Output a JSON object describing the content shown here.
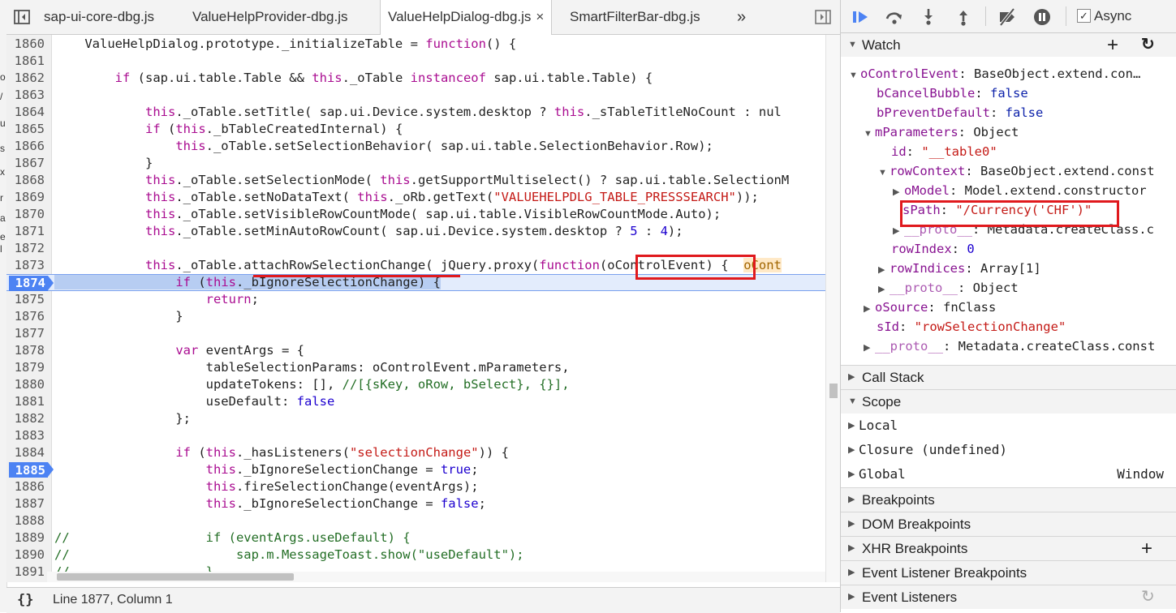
{
  "tabs": {
    "items": [
      {
        "label": "sap-ui-core-dbg.js"
      },
      {
        "label": "ValueHelpProvider-dbg.js"
      },
      {
        "label": "ValueHelpDialog-dbg.js",
        "close": "×"
      },
      {
        "label": "SmartFilterBar-dbg.js"
      }
    ],
    "more": "»"
  },
  "code": {
    "lines": [
      {
        "n": "1860",
        "t": "    ValueHelpDialog.prototype._initializeTable = function() {"
      },
      {
        "n": "1861",
        "t": ""
      },
      {
        "n": "1862",
        "t": "        if (sap.ui.table.Table && this._oTable instanceof sap.ui.table.Table) {"
      },
      {
        "n": "1863",
        "t": ""
      },
      {
        "n": "1864",
        "t": "            this._oTable.setTitle( sap.ui.Device.system.desktop ? this._sTableTitleNoCount : nul"
      },
      {
        "n": "1865",
        "t": "            if (this._bTableCreatedInternal) {"
      },
      {
        "n": "1866",
        "t": "                this._oTable.setSelectionBehavior( sap.ui.table.SelectionBehavior.Row);"
      },
      {
        "n": "1867",
        "t": "            }"
      },
      {
        "n": "1868",
        "t": "            this._oTable.setSelectionMode( this.getSupportMultiselect() ? sap.ui.table.SelectionM"
      },
      {
        "n": "1869",
        "t": "            this._oTable.setNoDataText( this._oRb.getText(\"VALUEHELPDLG_TABLE_PRESSSEARCH\"));"
      },
      {
        "n": "1870",
        "t": "            this._oTable.setVisibleRowCountMode( sap.ui.table.VisibleRowCountMode.Auto);"
      },
      {
        "n": "1871",
        "t": "            this._oTable.setMinAutoRowCount( sap.ui.Device.system.desktop ? 5 : 4);"
      },
      {
        "n": "1872",
        "t": ""
      },
      {
        "n": "1873",
        "t": "            this._oTable.attachRowSelectionChange( jQuery.proxy(function(oControlEvent) {  oCont"
      },
      {
        "n": "1874",
        "t": "                if (this._bIgnoreSelectionChange) {"
      },
      {
        "n": "1875",
        "t": "                    return;"
      },
      {
        "n": "1876",
        "t": "                }"
      },
      {
        "n": "1877",
        "t": ""
      },
      {
        "n": "1878",
        "t": "                var eventArgs = {"
      },
      {
        "n": "1879",
        "t": "                    tableSelectionParams: oControlEvent.mParameters,"
      },
      {
        "n": "1880",
        "t": "                    updateTokens: [], //[{sKey, oRow, bSelect}, {}],"
      },
      {
        "n": "1881",
        "t": "                    useDefault: false"
      },
      {
        "n": "1882",
        "t": "                };"
      },
      {
        "n": "1883",
        "t": ""
      },
      {
        "n": "1884",
        "t": "                if (this._hasListeners(\"selectionChange\")) {"
      },
      {
        "n": "1885",
        "t": "                    this._bIgnoreSelectionChange = true;"
      },
      {
        "n": "1886",
        "t": "                    this.fireSelectionChange(eventArgs);"
      },
      {
        "n": "1887",
        "t": "                    this._bIgnoreSelectionChange = false;"
      },
      {
        "n": "1888",
        "t": ""
      },
      {
        "n": "1889",
        "t": "//                  if (eventArgs.useDefault) {"
      },
      {
        "n": "1890",
        "t": "//                      sap.m.MessageToast.show(\"useDefault\");"
      },
      {
        "n": "1891",
        "t": "//                  }"
      }
    ],
    "breakpoints": [
      "1874",
      "1885"
    ],
    "current_line": "1874"
  },
  "statusbar": {
    "format_icon": "{}",
    "position": "Line 1877, Column 1"
  },
  "debugger": {
    "async_label": "Async",
    "async_checked": true,
    "watch": {
      "title": "Watch",
      "add": "+",
      "refresh": "↻",
      "nodes": [
        {
          "name": "oControlEvent",
          "sep": ": ",
          "value": "BaseObject.extend.con…"
        },
        {
          "name": "bCancelBubble",
          "sep": ": ",
          "value": "false"
        },
        {
          "name": "bPreventDefault",
          "sep": ": ",
          "value": "false"
        },
        {
          "name": "mParameters",
          "sep": ": ",
          "value": "Object"
        },
        {
          "name": "id",
          "sep": ": ",
          "value": "\"__table0\""
        },
        {
          "name": "rowContext",
          "sep": ": ",
          "value": "BaseObject.extend.const"
        },
        {
          "name": "oModel",
          "sep": ": ",
          "value": "Model.extend.constructor"
        },
        {
          "name": "sPath",
          "sep": ": ",
          "value": "\"/Currency('CHF')\""
        },
        {
          "name": "__proto__",
          "sep": ": ",
          "value": "Metadata.createClass.c"
        },
        {
          "name": "rowIndex",
          "sep": ": ",
          "value": "0"
        },
        {
          "name": "rowIndices",
          "sep": ": ",
          "value": "Array[1]"
        },
        {
          "name": "__proto__",
          "sep": ": ",
          "value": "Object"
        },
        {
          "name": "oSource",
          "sep": ": ",
          "value": "fnClass"
        },
        {
          "name": "sId",
          "sep": ": ",
          "value": "\"rowSelectionChange\""
        },
        {
          "name": "__proto__",
          "sep": ": ",
          "value": "Metadata.createClass.const"
        }
      ]
    },
    "call_stack": "Call Stack",
    "scope": {
      "title": "Scope",
      "items": [
        {
          "label": "Local",
          "value": ""
        },
        {
          "label": "Closure (undefined)",
          "value": ""
        },
        {
          "label": "Global",
          "value": "Window"
        }
      ]
    },
    "breakpoints": "Breakpoints",
    "dom_breakpoints": "DOM Breakpoints",
    "xhr_breakpoints": "XHR Breakpoints",
    "xhr_add": "+",
    "event_listener_breakpoints": "Event Listener Breakpoints",
    "event_listeners": "Event Listeners",
    "event_listeners_refresh": "↻"
  },
  "colors": {
    "keyword": "#aa0d91",
    "string": "#c41a16",
    "number": "#1c00cf",
    "comment": "#236e25",
    "breakpoint": "#4d83f3",
    "annotation": "#e0191d"
  },
  "left_strip": {
    "glyphs": [
      "o",
      "/",
      "u",
      "s",
      "x",
      "r",
      "a",
      "e",
      "l"
    ]
  }
}
